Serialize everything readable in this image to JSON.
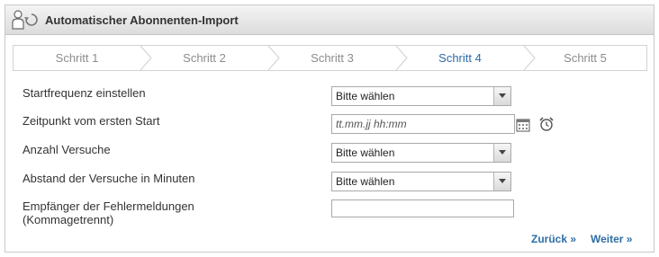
{
  "panel": {
    "title": "Automatischer Abonnenten-Import",
    "icon": "user-import-icon"
  },
  "wizard": {
    "active_step": 4,
    "steps": [
      {
        "label": "Schritt 1"
      },
      {
        "label": "Schritt 2"
      },
      {
        "label": "Schritt 3"
      },
      {
        "label": "Schritt 4"
      },
      {
        "label": "Schritt 5"
      }
    ]
  },
  "form": {
    "start_frequency": {
      "label": "Startfrequenz einstellen",
      "value": "Bitte wählen"
    },
    "first_start": {
      "label": "Zeitpunkt vom ersten Start",
      "placeholder": "tt.mm.jj hh:mm",
      "value": ""
    },
    "attempts": {
      "label": "Anzahl Versuche",
      "value": "Bitte wählen"
    },
    "attempt_interval": {
      "label": "Abstand der Versuche in Minuten",
      "value": "Bitte wählen"
    },
    "error_recipients": {
      "label_line1": "Empfänger der Fehlermeldungen",
      "label_line2": "(Kommagetrennt)",
      "value": ""
    }
  },
  "navigation": {
    "back_label": "Zurück »",
    "next_label": "Weiter »"
  },
  "colors": {
    "link": "#2e6da4",
    "active_step": "#2d6ba6",
    "inactive_step": "#8c8c8c"
  }
}
